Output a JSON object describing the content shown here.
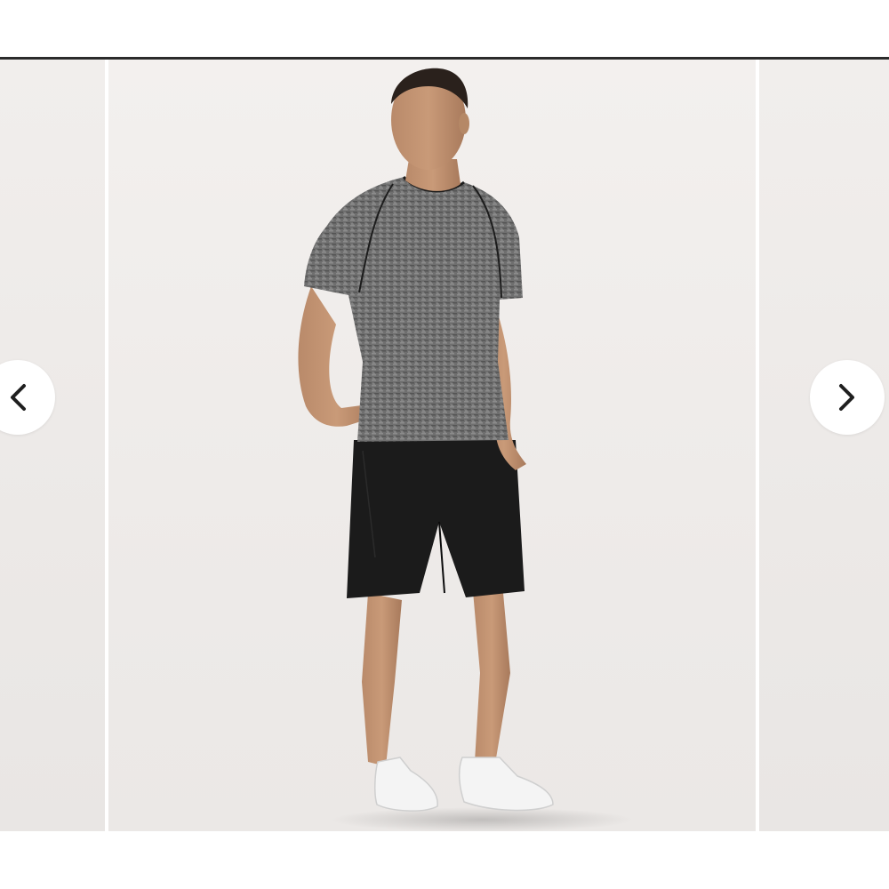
{
  "carousel": {
    "prev_icon": "chevron-left-icon",
    "next_icon": "chevron-right-icon",
    "image_subject": "model-standing",
    "colors": {
      "background": "#efecea",
      "rule": "#2b2b2b",
      "button": "#ffffff",
      "chevron": "#1f1f1f"
    }
  }
}
